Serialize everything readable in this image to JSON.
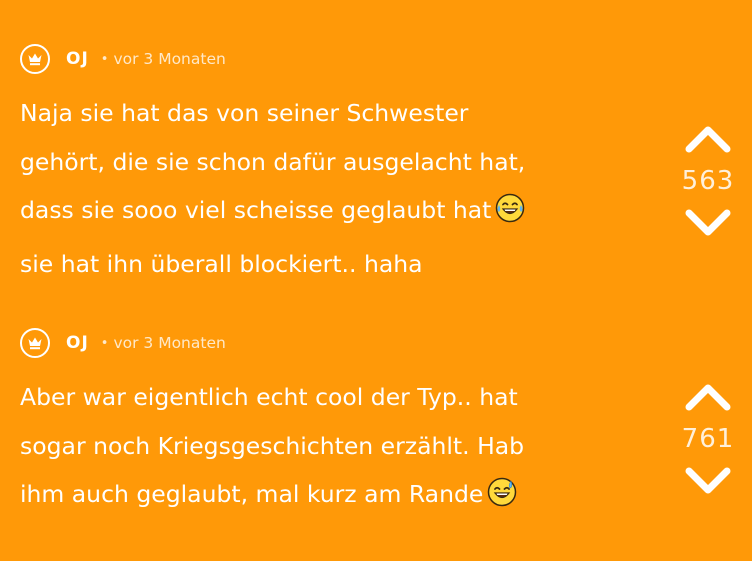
{
  "posts": [
    {
      "author": "OJ",
      "separator": "•",
      "timestamp": "vor 3 Monaten",
      "text": "Naja sie hat das von seiner Schwester\ngehört, die sie schon dafür ausgelacht hat,\ndass sie sooo viel scheisse geglaubt hat",
      "emoji": "face-with-tears-of-joy-icon",
      "text_after": "\nsie hat ihn überall blockiert.. haha",
      "votes": "563"
    },
    {
      "author": "OJ",
      "separator": "•",
      "timestamp": "vor 3 Monaten",
      "text": "Aber war eigentlich echt cool der Typ.. hat\nsogar noch Kriegsgeschichten erzählt. Hab\nihm auch geglaubt, mal kurz am Rande",
      "emoji": "grinning-face-with-sweat-icon",
      "text_after": "",
      "votes": "761"
    }
  ],
  "colors": {
    "background": "#FF9908",
    "foreground": "#FFFFFF"
  },
  "icons": {
    "badge": "crown-icon",
    "upvote": "chevron-up-icon",
    "downvote": "chevron-down-icon"
  }
}
